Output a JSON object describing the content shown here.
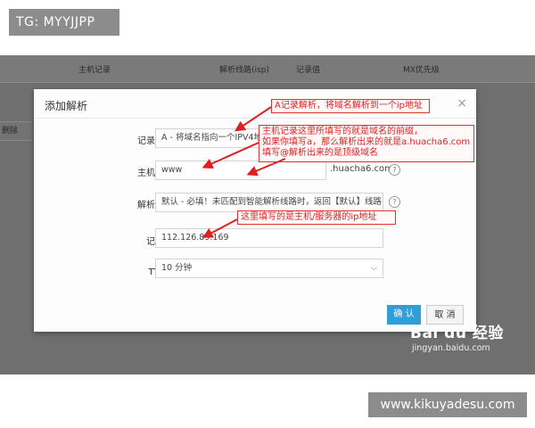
{
  "watermark_top": "TG: MYYJJPP",
  "watermark_bottom": "www.kikuyadesu.com",
  "background_table": {
    "columns": [
      "主机记录",
      "解析线路(isp)",
      "记录值",
      "MX优先级"
    ],
    "side_button": "删除"
  },
  "dialog": {
    "title": "添加解析",
    "close_glyph": "×",
    "fields": {
      "record_type": {
        "label": "记录类型：",
        "value": "A - 将域名指向一个IPV4地址"
      },
      "host_record": {
        "label": "主机记录：",
        "value": "www",
        "suffix": ".huacha6.com",
        "help": "?"
      },
      "line": {
        "label": "解析线路：",
        "value": "默认 - 必填！未匹配到智能解析线路时，返回【默认】线路…",
        "help": "?"
      },
      "record_value": {
        "label": "记录值：",
        "value": "112.126.89.169"
      },
      "ttl": {
        "label": "TTL值：",
        "value": "10 分钟"
      }
    },
    "confirm_label": "确 认",
    "cancel_label": "取 消"
  },
  "annotations": {
    "a_record": "A记录解析，将域名解析到一个ip地址",
    "host_note": [
      "主机记录这里所填写的就是域名的前缀，",
      "如果你填写a，那么解析出来的就是a.huacha6.com",
      "填写@解析出来的是顶级域名"
    ],
    "value_note": "这里填写的是主机/服务器的ip地址"
  },
  "baidu": {
    "logo": "Bai du 经验",
    "sub": "jingyan.baidu.com"
  },
  "colors": {
    "annotation_red": "#e01f1f",
    "confirm_blue": "#2f9fd8",
    "overlay_gray": "#6f6f6f"
  }
}
